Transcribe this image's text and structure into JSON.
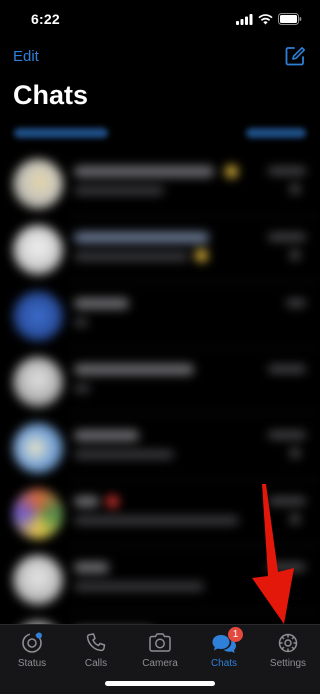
{
  "status_bar": {
    "time": "6:22"
  },
  "nav": {
    "edit_label": "Edit"
  },
  "header": {
    "title": "Chats"
  },
  "tabs": [
    {
      "label": "Status"
    },
    {
      "label": "Calls"
    },
    {
      "label": "Camera"
    },
    {
      "label": "Chats",
      "badge": "1"
    },
    {
      "label": "Settings"
    }
  ],
  "colors": {
    "accent": "#2f80d8",
    "badge": "#e5483d",
    "arrow": "#e3170a",
    "tab_bar": "#161618"
  }
}
